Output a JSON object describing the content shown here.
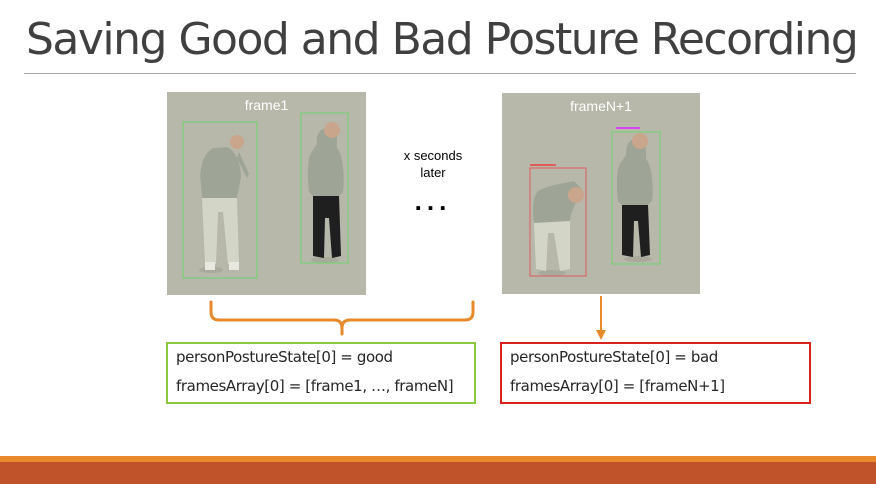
{
  "slide": {
    "title": "Saving Good and Bad Posture Recording"
  },
  "frames": {
    "left_label": "frame1",
    "right_label": "frameN+1"
  },
  "middle": {
    "caption": "x seconds\nlater",
    "ellipsis": "..."
  },
  "good_box": {
    "line1": "personPostureState[0] = good",
    "line2": "framesArray[0] = [frame1, …, frameN]",
    "border_color": "#8dc63f"
  },
  "bad_box": {
    "line1": "personPostureState[0] = bad",
    "line2": "framesArray[0] = [frameN+1]",
    "border_color": "#d9221c"
  },
  "colors": {
    "accent_orange": "#e8892b",
    "footer_dark": "#c0532a",
    "detection_good": "#6fd36f",
    "detection_bad": "#e05a5a"
  }
}
